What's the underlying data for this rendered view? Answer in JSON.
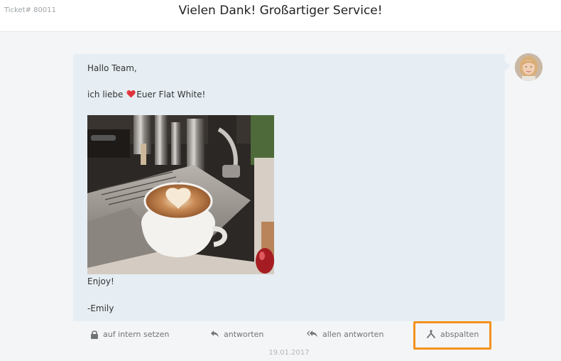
{
  "header": {
    "ticket_number": "Ticket# 80011",
    "title": "Vielen Dank! Großartiger Service!"
  },
  "message": {
    "greeting": "Hallo Team,",
    "body_prefix": "ich liebe ",
    "body_suffix": "Euer Flat White!",
    "closing": "Enjoy!",
    "signature": "-Emily",
    "heart_color": "#e0323b",
    "bubble_color": "#e6eef4"
  },
  "actions": {
    "internal_label": "auf intern setzen",
    "reply_label": "antworten",
    "reply_all_label": "allen antworten",
    "split_label": "abspalten",
    "highlight_color": "#f5921e"
  },
  "meta": {
    "date": "19.01.2017"
  }
}
